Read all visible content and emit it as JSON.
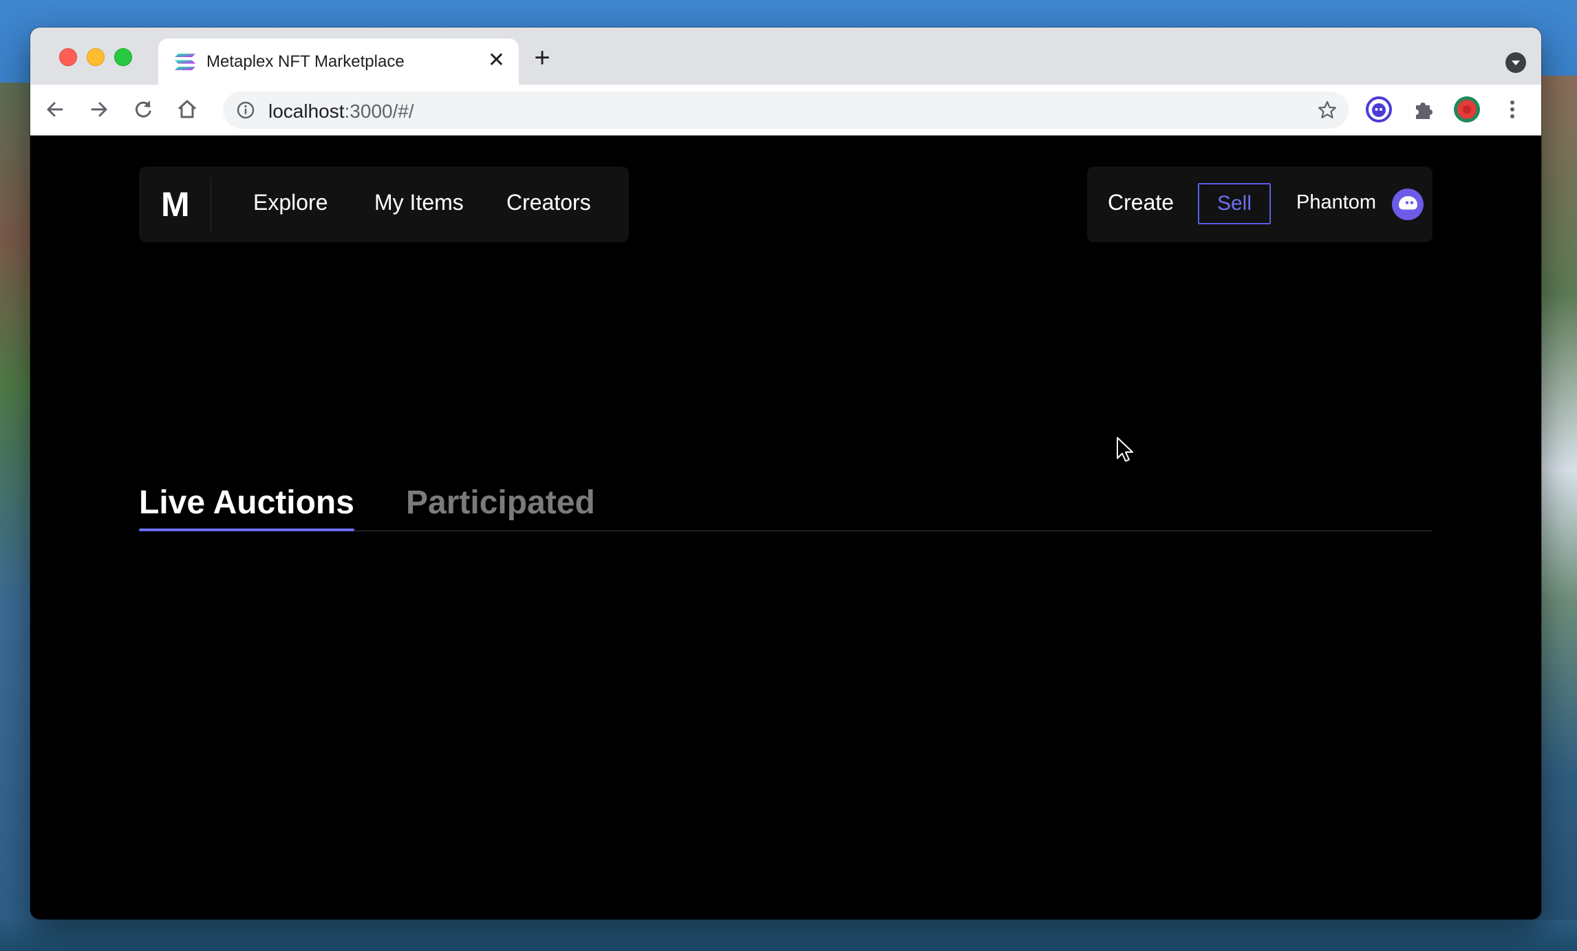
{
  "browser": {
    "tab": {
      "title": "Metaplex NFT Marketplace",
      "favicon": "solana-logo-icon",
      "close_glyph": "✕"
    },
    "new_tab_glyph": "+",
    "address_bar": {
      "host": "localhost",
      "path": ":3000/#/"
    },
    "extensions": [
      "phantom-extension-icon",
      "puzzle-extensions-icon",
      "profile-avatar-icon"
    ],
    "menu_icon": "kebab-menu-icon"
  },
  "app": {
    "logo": "M",
    "nav": [
      {
        "label": "Explore"
      },
      {
        "label": "My Items"
      },
      {
        "label": "Creators"
      }
    ],
    "actions": {
      "create_label": "Create",
      "sell_label": "Sell",
      "wallet_label": "Phantom"
    },
    "tabs": [
      {
        "label": "Live Auctions",
        "active": true
      },
      {
        "label": "Participated",
        "active": false
      }
    ],
    "colors": {
      "accent": "#6b6ef2",
      "phantom": "#6c5ce7",
      "background": "#000000",
      "panel": "#121212"
    }
  }
}
